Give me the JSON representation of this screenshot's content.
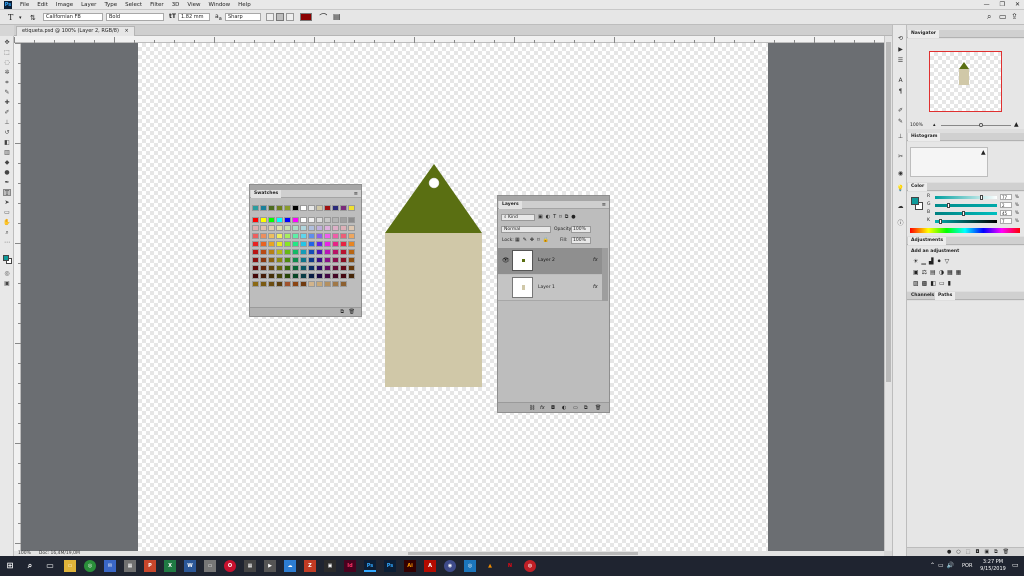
{
  "app": {
    "logo": "Ps",
    "menus": [
      "File",
      "Edit",
      "Image",
      "Layer",
      "Type",
      "Select",
      "Filter",
      "3D",
      "View",
      "Window",
      "Help"
    ],
    "window_controls": [
      "—",
      "❐",
      "✕"
    ]
  },
  "options_bar": {
    "tool_glyph": "T",
    "font_family": "Californian FB",
    "font_style": "Bold",
    "font_size": "1.82 mm",
    "anti_alias": "Sharp",
    "text_color": "#8b0000"
  },
  "document": {
    "tab_label": "etiqueta.psd @ 100% (Layer 2, RGB/8)",
    "zoom": "100%",
    "doc_info": "Doc: 16,4M/19,0M"
  },
  "artwork": {
    "tag_top_color": "#5a6f12",
    "tag_body_color": "#d0c8a8"
  },
  "swatches_panel": {
    "tab": "Swatches",
    "menu_glyph": "≡"
  },
  "layers_panel": {
    "tab": "Layers",
    "menu_glyph": "≡",
    "filter_kind": "Kind",
    "blend_mode": "Normal",
    "opacity_label": "Opacity:",
    "opacity_value": "100%",
    "lock_label": "Lock:",
    "fill_label": "Fill:",
    "fill_value": "100%",
    "layers": [
      {
        "name": "Layer 2",
        "fx": "fx",
        "selected": true,
        "visible": true
      },
      {
        "name": "Layer 1",
        "fx": "fx",
        "selected": false,
        "visible": false
      }
    ],
    "footer_glyphs": [
      "⛓",
      "fx",
      "◘",
      "◐",
      "▭",
      "⧉",
      "🗑"
    ]
  },
  "navigator_panel": {
    "tab": "Navigator",
    "zoom": "100%"
  },
  "histogram_panel": {
    "tab": "Histogram"
  },
  "color_panel": {
    "tab": "Color",
    "channels": [
      {
        "label": "R",
        "value": "77",
        "unit": "%",
        "fill": 0.77,
        "track": "linear-gradient(to right,#00a0a0,#ffffff)"
      },
      {
        "label": "G",
        "value": "2",
        "unit": "%",
        "fill": 0.2,
        "track": "linear-gradient(to right,#008b8b,#00aaaa)"
      },
      {
        "label": "B",
        "value": "45",
        "unit": "%",
        "fill": 0.45,
        "track": "linear-gradient(to right,#008080,#00c0c0)"
      },
      {
        "label": "K",
        "value": "7",
        "unit": "%",
        "fill": 0.07,
        "track": "linear-gradient(to right,#00b0b0,#000000)"
      }
    ],
    "fg_color": "#0e9a9a",
    "bg_color": "#ffffff"
  },
  "adjustments_panel": {
    "tab": "Adjustments",
    "title": "Add an adjustment"
  },
  "channels_paths": {
    "tabs": [
      "Channels",
      "Paths"
    ],
    "active": "Paths"
  },
  "taskbar": {
    "clock_time": "3:27 PM",
    "clock_date": "9/15/2019",
    "language": "POR"
  }
}
